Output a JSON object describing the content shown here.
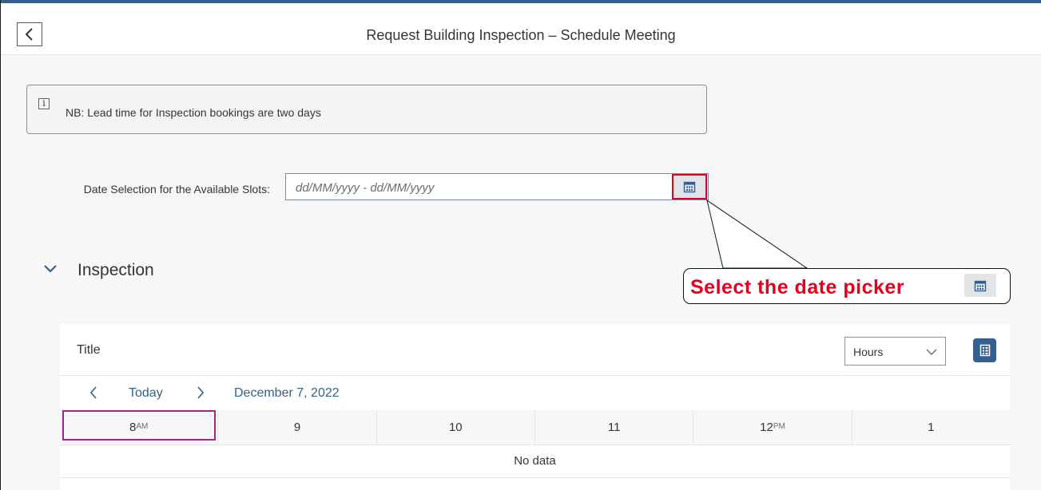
{
  "header": {
    "title": "Request Building Inspection – Schedule Meeting",
    "back_icon": "chevron-left-icon"
  },
  "info": {
    "icon": "info-icon",
    "icon_glyph": "i",
    "text": "NB: Lead time for Inspection bookings are two days"
  },
  "date_field": {
    "label": "Date Selection for the Available Slots:",
    "placeholder": "dd/MM/yyyy - dd/MM/yyyy",
    "value": "",
    "button_icon": "calendar-icon"
  },
  "section": {
    "title": "Inspection",
    "expanded": true
  },
  "callout": {
    "text": "Select the date picker",
    "color": "#e5001f"
  },
  "planning": {
    "title": "Title",
    "view": "Hours",
    "legend_icon": "legend-icon",
    "nav": {
      "today": "Today",
      "date": "December 7, 2022"
    },
    "hours": [
      {
        "num": "8",
        "suffix": "AM"
      },
      {
        "num": "9",
        "suffix": ""
      },
      {
        "num": "10",
        "suffix": ""
      },
      {
        "num": "11",
        "suffix": ""
      },
      {
        "num": "12",
        "suffix": "PM"
      },
      {
        "num": "1",
        "suffix": ""
      }
    ],
    "empty_text": "No data"
  },
  "colors": {
    "accent": "#355f8f",
    "link": "#346187",
    "highlight_red": "#e5001f",
    "highlight_purple": "#a12290"
  }
}
